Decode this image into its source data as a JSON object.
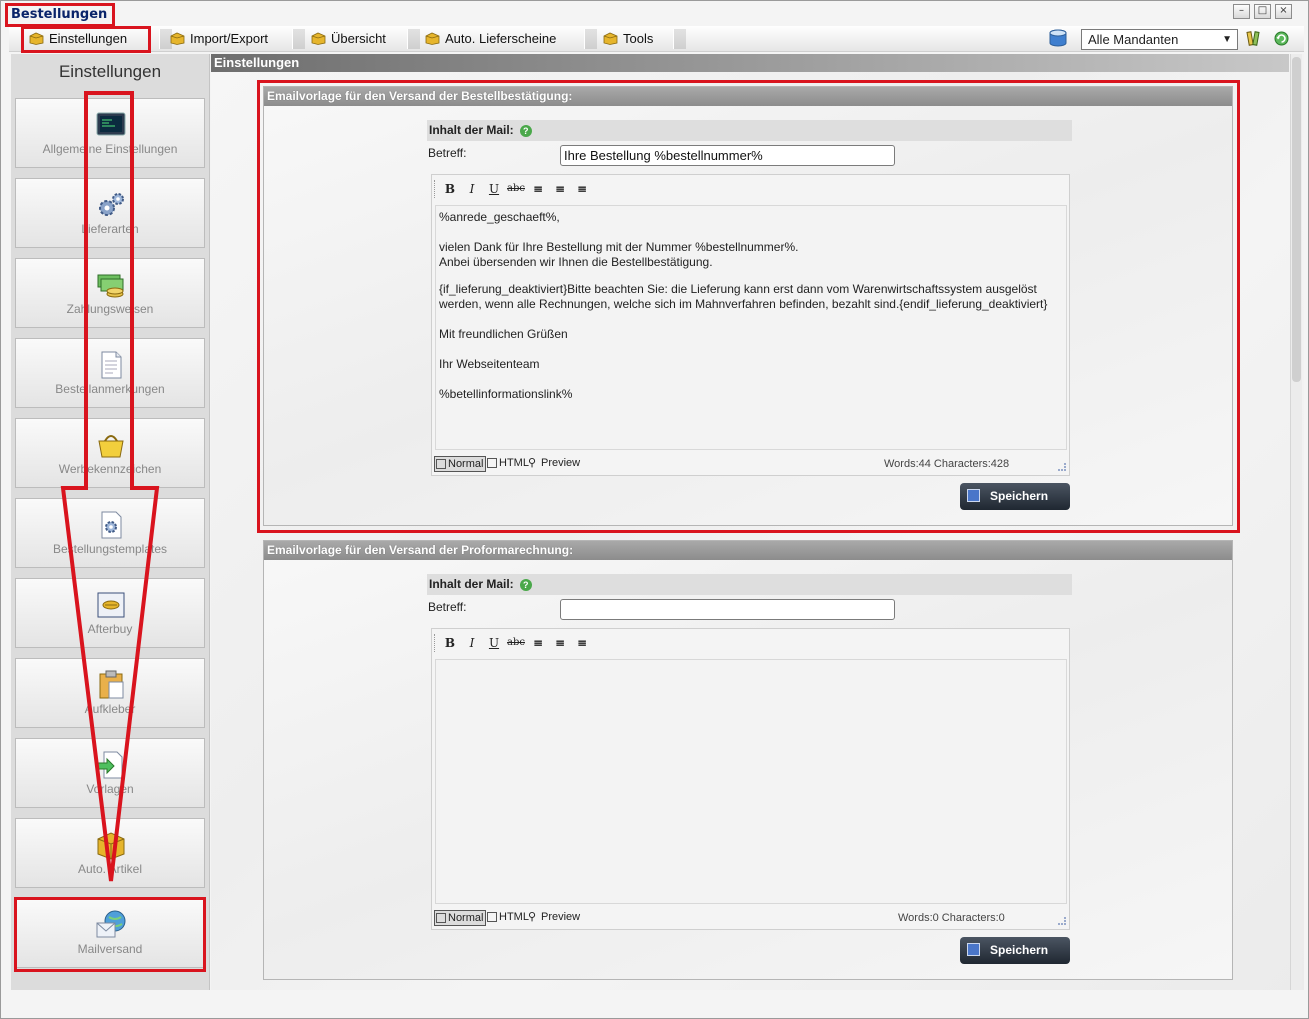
{
  "window": {
    "title": "Bestellungen",
    "controls": [
      "–",
      "□",
      "×"
    ]
  },
  "tabs": [
    {
      "label": "Einstellungen",
      "active": true
    },
    {
      "label": "Import/Export",
      "active": false
    },
    {
      "label": "Übersicht",
      "active": false
    },
    {
      "label": "Auto. Lieferscheine",
      "active": false
    },
    {
      "label": "Tools",
      "active": false
    }
  ],
  "mandant": {
    "selected": "Alle Mandanten"
  },
  "sidebar": {
    "title": "Einstellungen",
    "items": [
      {
        "label": "Allgemeine Einstellungen",
        "icon": "terminal-icon"
      },
      {
        "label": "Lieferarten",
        "icon": "gears-icon"
      },
      {
        "label": "Zahlungsweisen",
        "icon": "money-icon"
      },
      {
        "label": "Bestellanmerkungen",
        "icon": "notepad-icon"
      },
      {
        "label": "Werbekennzeichen",
        "icon": "basket-icon"
      },
      {
        "label": "Bestellungstemplates",
        "icon": "document-gear-icon"
      },
      {
        "label": "Afterbuy",
        "icon": "afterbuy-icon"
      },
      {
        "label": "Aufkleber",
        "icon": "clipboard-icon"
      },
      {
        "label": "Vorlagen",
        "icon": "document-arrow-icon"
      },
      {
        "label": "Auto. Artikel",
        "icon": "box-icon"
      },
      {
        "label": "Mailversand",
        "icon": "mail-globe-icon"
      }
    ]
  },
  "content": {
    "header": "Einstellungen",
    "panels": [
      {
        "title": "Emailvorlage für den Versand der Bestellbestätigung:",
        "inhalt_label": "Inhalt der Mail:",
        "betreff_label": "Betreff:",
        "betreff_value": "Ihre Bestellung %bestellnummer%",
        "body_lines": [
          "%anrede_geschaeft%,",
          "",
          "vielen Dank für Ihre Bestellung mit der Nummer %bestellnummer%.",
          "Anbei übersenden wir Ihnen die Bestellbestätigung.",
          "",
          "{if_lieferung_deaktiviert}Bitte beachten Sie: die Lieferung kann erst dann vom Warenwirtschaftssystem ausgelöst",
          "werden, wenn alle Rechnungen, welche sich im Mahnverfahren befinden, bezahlt sind.{endif_lieferung_deaktiviert}",
          "",
          "Mit freundlichen Grüßen",
          "",
          "Ihr Webseitenteam",
          "",
          "%betellinformationslink%"
        ],
        "modes": [
          "Normal",
          "HTML",
          "Preview"
        ],
        "counts": "Words:44 Characters:428",
        "save_label": "Speichern"
      },
      {
        "title": "Emailvorlage für den Versand der Proformarechnung:",
        "inhalt_label": "Inhalt der Mail:",
        "betreff_label": "Betreff:",
        "betreff_value": "",
        "body_lines": [],
        "modes": [
          "Normal",
          "HTML",
          "Preview"
        ],
        "counts": "Words:0 Characters:0",
        "save_label": "Speichern"
      }
    ]
  },
  "toolbar_buttons": [
    {
      "label": "B",
      "name": "bold-button"
    },
    {
      "label": "I",
      "name": "italic-button"
    },
    {
      "label": "U",
      "name": "underline-button"
    },
    {
      "label": "abc",
      "name": "strikethrough-button"
    },
    {
      "label": "≡",
      "name": "align-left-button"
    },
    {
      "label": "≡",
      "name": "align-center-button"
    },
    {
      "label": "≡",
      "name": "align-right-button"
    }
  ],
  "colors": {
    "highlight": "#d9141e",
    "title_text": "#0a246a",
    "save_button": "#1f2731",
    "panel_header": "#8c8c8c"
  }
}
